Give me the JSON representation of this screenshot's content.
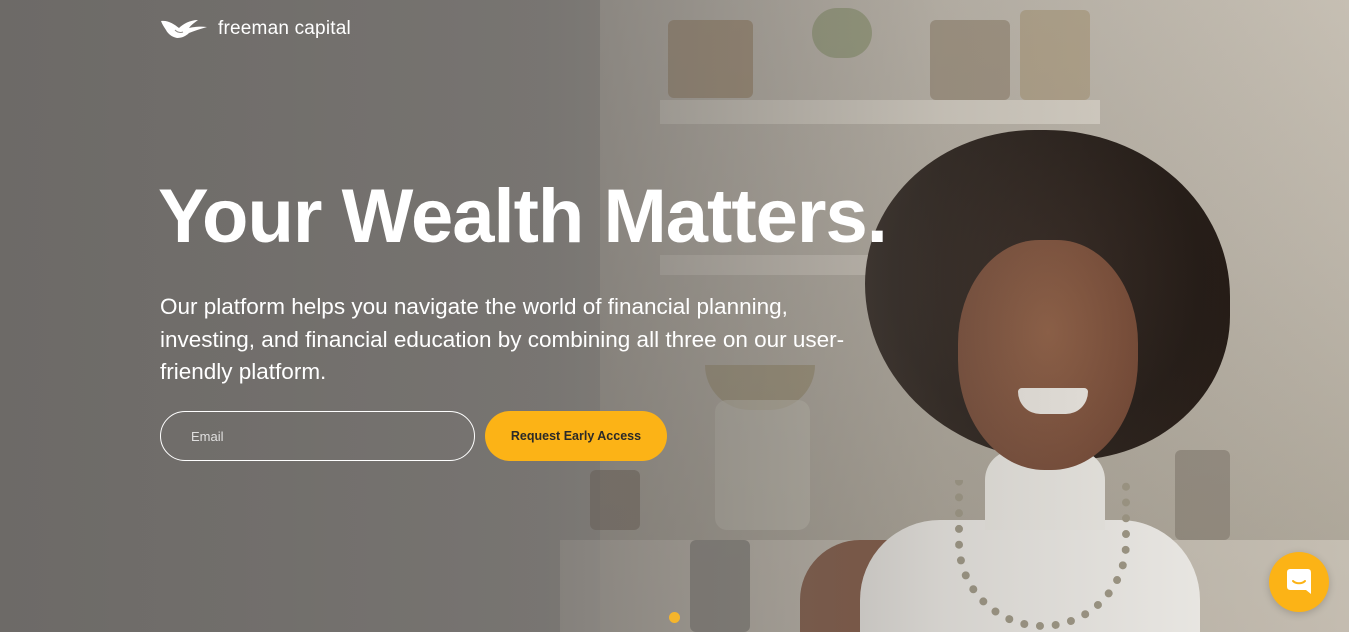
{
  "brand": {
    "name": "freeman capital",
    "logo_icon": "bird-wing-logo-icon"
  },
  "hero": {
    "headline": "Your Wealth Matters.",
    "subtext": "Our platform helps you navigate the world of financial planning, investing, and financial education by combining all three on our user-friendly platform.",
    "email_placeholder": "Email",
    "email_value": "",
    "cta_label": "Request Early Access",
    "background_image": "smiling-woman-in-kitchen-photo"
  },
  "slider": {
    "active_index": 1,
    "dot_color": "#f5b52c"
  },
  "chat_widget": {
    "icon": "chat-bubble-icon",
    "color": "#fcb316"
  },
  "colors": {
    "accent": "#fcb316",
    "text": "#ffffff",
    "button_text": "#2b2a28"
  }
}
